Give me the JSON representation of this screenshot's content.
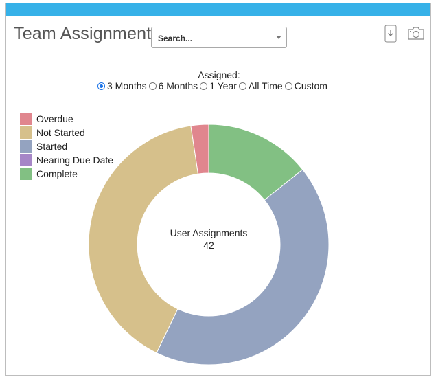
{
  "header": {
    "title": "Team Assignments",
    "search_placeholder": "Search...",
    "download_icon": "download-icon",
    "camera_icon": "camera-icon",
    "accent_color": "#36b1e8"
  },
  "filter": {
    "label": "Assigned:",
    "options": [
      "3 Months",
      "6 Months",
      "1 Year",
      "All Time",
      "Custom"
    ],
    "selected": "3 Months"
  },
  "chart_data": {
    "type": "pie",
    "donut": true,
    "center_title": "User Assignments",
    "center_value": "42",
    "legend_position": "top-left",
    "categories": [
      "Overdue",
      "Not Started",
      "Started",
      "Nearing Due Date",
      "Complete"
    ],
    "values": [
      1,
      17,
      18,
      0,
      6
    ],
    "colors": [
      "#e0868e",
      "#d6c08b",
      "#94a3c0",
      "#a686c7",
      "#82c083"
    ]
  }
}
